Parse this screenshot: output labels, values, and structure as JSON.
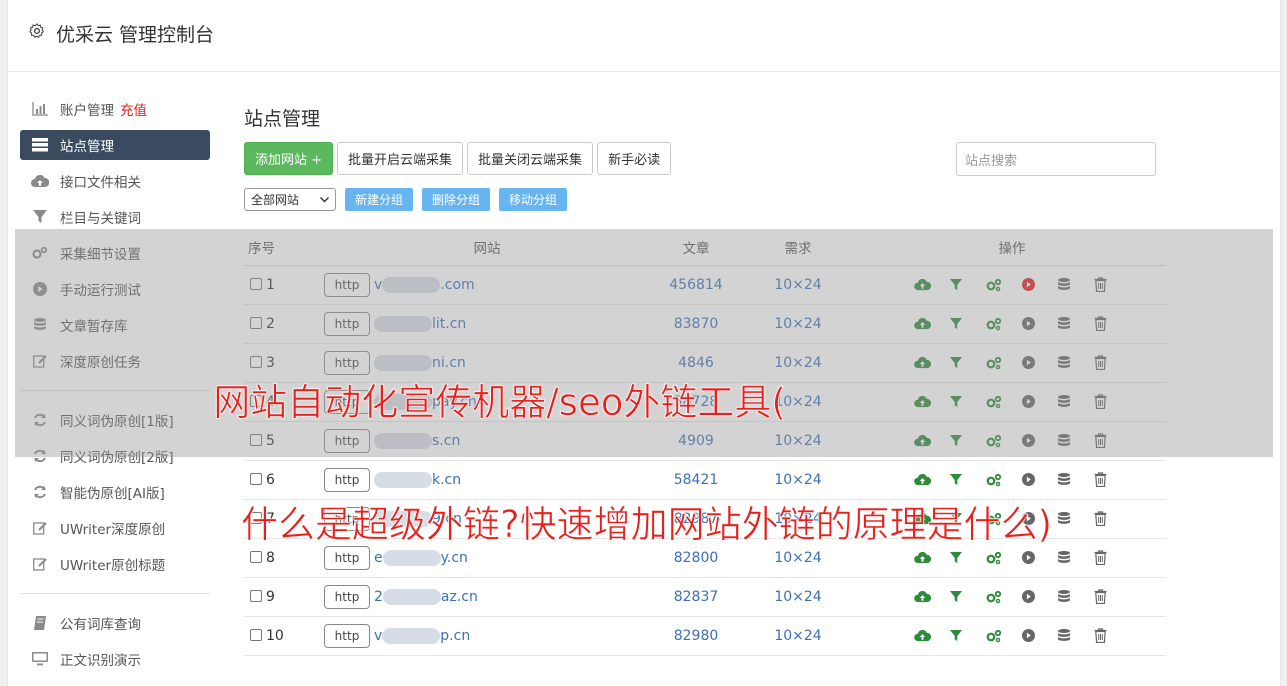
{
  "header": {
    "title": "优采云 管理控制台",
    "icon": "gear-icon"
  },
  "sidebar": {
    "items": [
      {
        "label": "账户管理",
        "extra": "充值",
        "icon": "bar-chart-icon"
      },
      {
        "label": "站点管理",
        "icon": "server-icon",
        "active": true
      },
      {
        "label": "接口文件相关",
        "icon": "cloud-upload-icon"
      },
      {
        "label": "栏目与关键词",
        "icon": "filter-icon"
      },
      {
        "label": "采集细节设置",
        "icon": "cogs-icon"
      },
      {
        "label": "手动运行测试",
        "icon": "play-icon"
      },
      {
        "label": "文章暂存库",
        "icon": "database-icon"
      },
      {
        "label": "深度原创任务",
        "icon": "edit-icon"
      },
      {
        "label": "同义词伪原创[1版]",
        "icon": "refresh-icon"
      },
      {
        "label": "同义词伪原创[2版]",
        "icon": "refresh-icon"
      },
      {
        "label": "智能伪原创[AI版]",
        "icon": "refresh-icon"
      },
      {
        "label": "UWriter深度原创",
        "icon": "edit-icon"
      },
      {
        "label": "UWriter原创标题",
        "icon": "edit-icon"
      },
      {
        "label": "公有词库查询",
        "icon": "book-icon"
      },
      {
        "label": "正文识别演示",
        "icon": "monitor-icon"
      }
    ]
  },
  "main": {
    "title": "站点管理",
    "toolbar": {
      "add": "添加网站 +",
      "batch_open": "批量开启云端采集",
      "batch_close": "批量关闭云端采集",
      "guide": "新手必读"
    },
    "search_placeholder": "站点搜索",
    "group_select": "全部网站",
    "group_buttons": {
      "new": "新建分组",
      "delete": "删除分组",
      "move": "移动分组"
    },
    "table": {
      "headers": {
        "no": "序号",
        "site": "网站",
        "articles": "文章",
        "demand": "需求",
        "ops": "操作"
      },
      "http_label": "http",
      "rows": [
        {
          "no": "1",
          "domain_prefix": "v",
          "domain_suffix": ".com",
          "articles": "456814",
          "demand": "10×24",
          "running": true
        },
        {
          "no": "2",
          "domain_prefix": "",
          "domain_suffix": "lit.cn",
          "articles": "83870",
          "demand": "10×24",
          "running": false
        },
        {
          "no": "3",
          "domain_prefix": "",
          "domain_suffix": "ni.cn",
          "articles": "4846",
          "demand": "10×24",
          "running": false
        },
        {
          "no": "4",
          "domain_prefix": "",
          "domain_suffix": "pay.cn",
          "articles": "58728",
          "demand": "10×24",
          "running": false
        },
        {
          "no": "5",
          "domain_prefix": "",
          "domain_suffix": "s.cn",
          "articles": "4909",
          "demand": "10×24",
          "running": false
        },
        {
          "no": "6",
          "domain_prefix": "",
          "domain_suffix": "k.cn",
          "articles": "58421",
          "demand": "10×24",
          "running": false
        },
        {
          "no": "7",
          "domain_prefix": "",
          "domain_suffix": "9.cn",
          "articles": "82987",
          "demand": "10×24",
          "running": false
        },
        {
          "no": "8",
          "domain_prefix": "e",
          "domain_suffix": "y.cn",
          "articles": "82800",
          "demand": "10×24",
          "running": false
        },
        {
          "no": "9",
          "domain_prefix": "2",
          "domain_suffix": "az.cn",
          "articles": "82837",
          "demand": "10×24",
          "running": false
        },
        {
          "no": "10",
          "domain_prefix": "v",
          "domain_suffix": "p.cn",
          "articles": "82980",
          "demand": "10×24",
          "running": false
        }
      ]
    }
  },
  "overlay": {
    "line1": "网站自动化宣传机器/seo外链工具(",
    "line2": "什么是超级外链?快速增加网站外链的原理是什么)"
  },
  "colors": {
    "green": "#5cb85c",
    "nav_active": "#3a4a5f",
    "link": "#3a70b8",
    "banner": "#e8201c",
    "play_running": "#e02020"
  }
}
